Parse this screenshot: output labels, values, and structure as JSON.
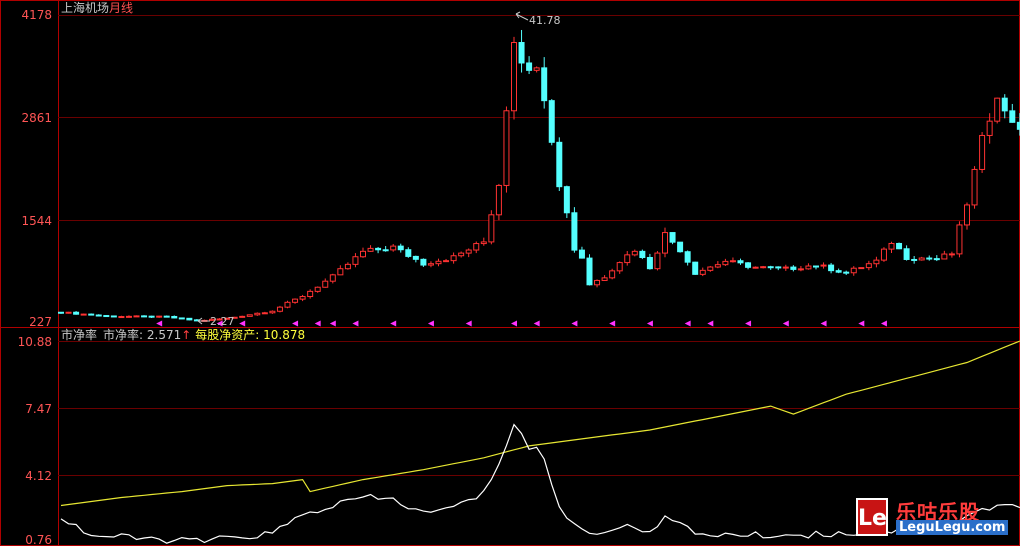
{
  "upper": {
    "title": "上海机场",
    "period": "月线",
    "y_ticks": [
      "4178",
      "2861",
      "1544",
      "227"
    ],
    "high_label": "41.78",
    "low_label": "2.27"
  },
  "lower": {
    "indicator_name": "市净率",
    "pb_label": "市净率: 2.571",
    "pb_arrow": "↑",
    "bvps_label": "每股净资产: 10.878",
    "y_ticks": [
      "10.88",
      "7.47",
      "4.12",
      "0.76"
    ]
  },
  "watermark": {
    "logo": "Le",
    "name": "乐咕乐股",
    "url": "LeguLegu.com"
  },
  "colors": {
    "background": "#000000",
    "frame": "#b00000",
    "grid": "#6a0000",
    "up": "#ff3232",
    "down": "#54ffff",
    "pb_line": "#ffffff",
    "bvps_line": "#e6e632",
    "title_white": "#c8c8c8",
    "title_red": "#ff5050",
    "yellow_text": "#ffff3c",
    "marker": "#ff32ff"
  },
  "chart_data": [
    {
      "type": "candlestick",
      "title": "上海机场 月线",
      "ylim": [
        227,
        4178
      ],
      "y_ticks": [
        227,
        1544,
        2861,
        4178
      ],
      "annotations": [
        {
          "text": "41.78",
          "at_index": 60,
          "kind": "high"
        },
        {
          "text": "2.27",
          "at_index": 18,
          "kind": "low"
        }
      ],
      "marker_indices": [
        13,
        21,
        24,
        31,
        34,
        36,
        39,
        44,
        49,
        54,
        60,
        63,
        68,
        73,
        78,
        83,
        86,
        91,
        96,
        101,
        106,
        109
      ]
    },
    {
      "type": "line",
      "indicator": "市净率",
      "ylim": [
        0.76,
        10.88
      ],
      "y_ticks": [
        0.76,
        4.12,
        7.47,
        10.88
      ],
      "series": [
        {
          "name": "市净率",
          "last": 2.571
        },
        {
          "name": "每股净资产",
          "last": 10.878
        }
      ]
    }
  ]
}
